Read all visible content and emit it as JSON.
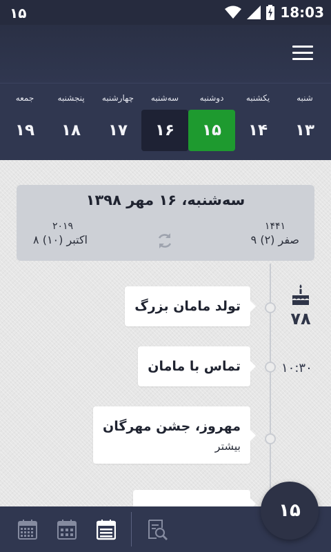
{
  "status_bar": {
    "notification": "۱۵",
    "time": "18:03"
  },
  "week": [
    {
      "name": "شنبه",
      "num": "۱۳",
      "state": "normal"
    },
    {
      "name": "یکشنبه",
      "num": "۱۴",
      "state": "normal"
    },
    {
      "name": "دوشنبه",
      "num": "۱۵",
      "state": "today"
    },
    {
      "name": "سه‌شنبه",
      "num": "۱۶",
      "state": "selected"
    },
    {
      "name": "چهارشنبه",
      "num": "۱۷",
      "state": "normal"
    },
    {
      "name": "پنجشنبه",
      "num": "۱۸",
      "state": "normal"
    },
    {
      "name": "جمعه",
      "num": "۱۹",
      "state": "normal"
    }
  ],
  "date_card": {
    "title": "سه‌شنبه، ۱۶ مهر ۱۳۹۸",
    "hijri_year": "۱۴۴۱",
    "hijri_date": "۹ صفر (۲)",
    "gregorian_year": "۲۰۱۹",
    "gregorian_date": "۸ اکتبر (۱۰)"
  },
  "events": [
    {
      "title": "تولد مامان بزرگ",
      "sub": ""
    },
    {
      "title": "تماس با مامان",
      "sub": ""
    },
    {
      "title": "مهروز، جشن مهرگان",
      "sub": "بیشتر"
    }
  ],
  "age": "۷۸",
  "event_time": "۱۰:۳۰",
  "fab_label": "۱۵",
  "icons": {
    "menu": "hamburger-icon",
    "sync": "sync-icon",
    "birthday": "cake-icon",
    "bottom": [
      "month-view-icon",
      "week-view-icon",
      "day-view-icon",
      "search-calendar-icon"
    ]
  },
  "colors": {
    "primary": "#303750",
    "today": "#1e9a2f",
    "selected": "#1e2234"
  }
}
